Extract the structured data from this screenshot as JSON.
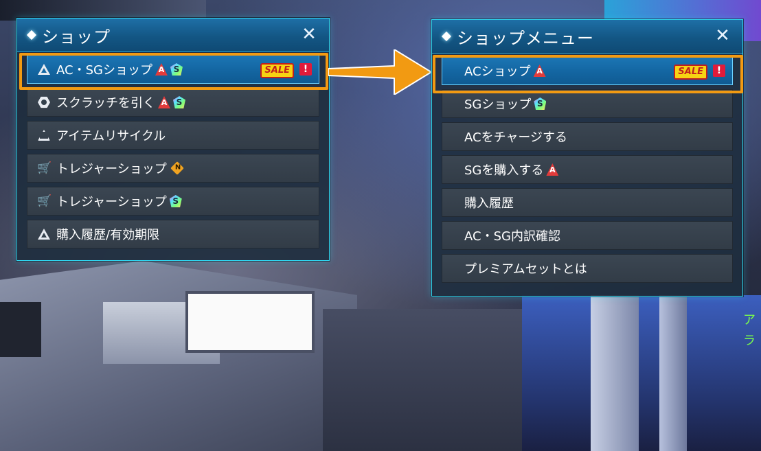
{
  "left_panel": {
    "title": "ショップ",
    "close_label": "✕",
    "items": [
      {
        "label": "AC・SGショップ",
        "icon": "warning-triangle-icon",
        "badges": [
          "ac-icon",
          "sg-icon"
        ],
        "sale": "SALE",
        "alert": "!",
        "selected": true
      },
      {
        "label": "スクラッチを引く",
        "icon": "scratch-icon",
        "badges": [
          "ac-icon",
          "sg-icon"
        ]
      },
      {
        "label": "アイテムリサイクル",
        "icon": "recycle-icon",
        "badges": []
      },
      {
        "label": "トレジャーショップ",
        "icon": "cart-icon",
        "badges": [
          "n-icon"
        ]
      },
      {
        "label": "トレジャーショップ",
        "icon": "cart-icon",
        "badges": [
          "sg-icon"
        ]
      },
      {
        "label": "購入履歴/有効期限",
        "icon": "history-triangle-icon",
        "badges": []
      }
    ]
  },
  "right_panel": {
    "title": "ショップメニュー",
    "close_label": "✕",
    "items": [
      {
        "label": "ACショップ",
        "badges": [
          "ac-icon"
        ],
        "sale": "SALE",
        "alert": "!",
        "selected": true
      },
      {
        "label": "SGショップ",
        "badges": [
          "sg-icon"
        ]
      },
      {
        "label": "ACをチャージする",
        "badges": []
      },
      {
        "label": "SGを購入する",
        "badges": [
          "ac-icon"
        ]
      },
      {
        "label": "購入履歴",
        "badges": []
      },
      {
        "label": "AC・SG内訳確認",
        "badges": []
      },
      {
        "label": "プレミアムセットとは",
        "badges": []
      }
    ]
  },
  "side_text": "ア\nラ",
  "colors": {
    "highlight": "#f29a12",
    "panel_border": "#2fd6f0",
    "selected_row": "#1467a3"
  }
}
